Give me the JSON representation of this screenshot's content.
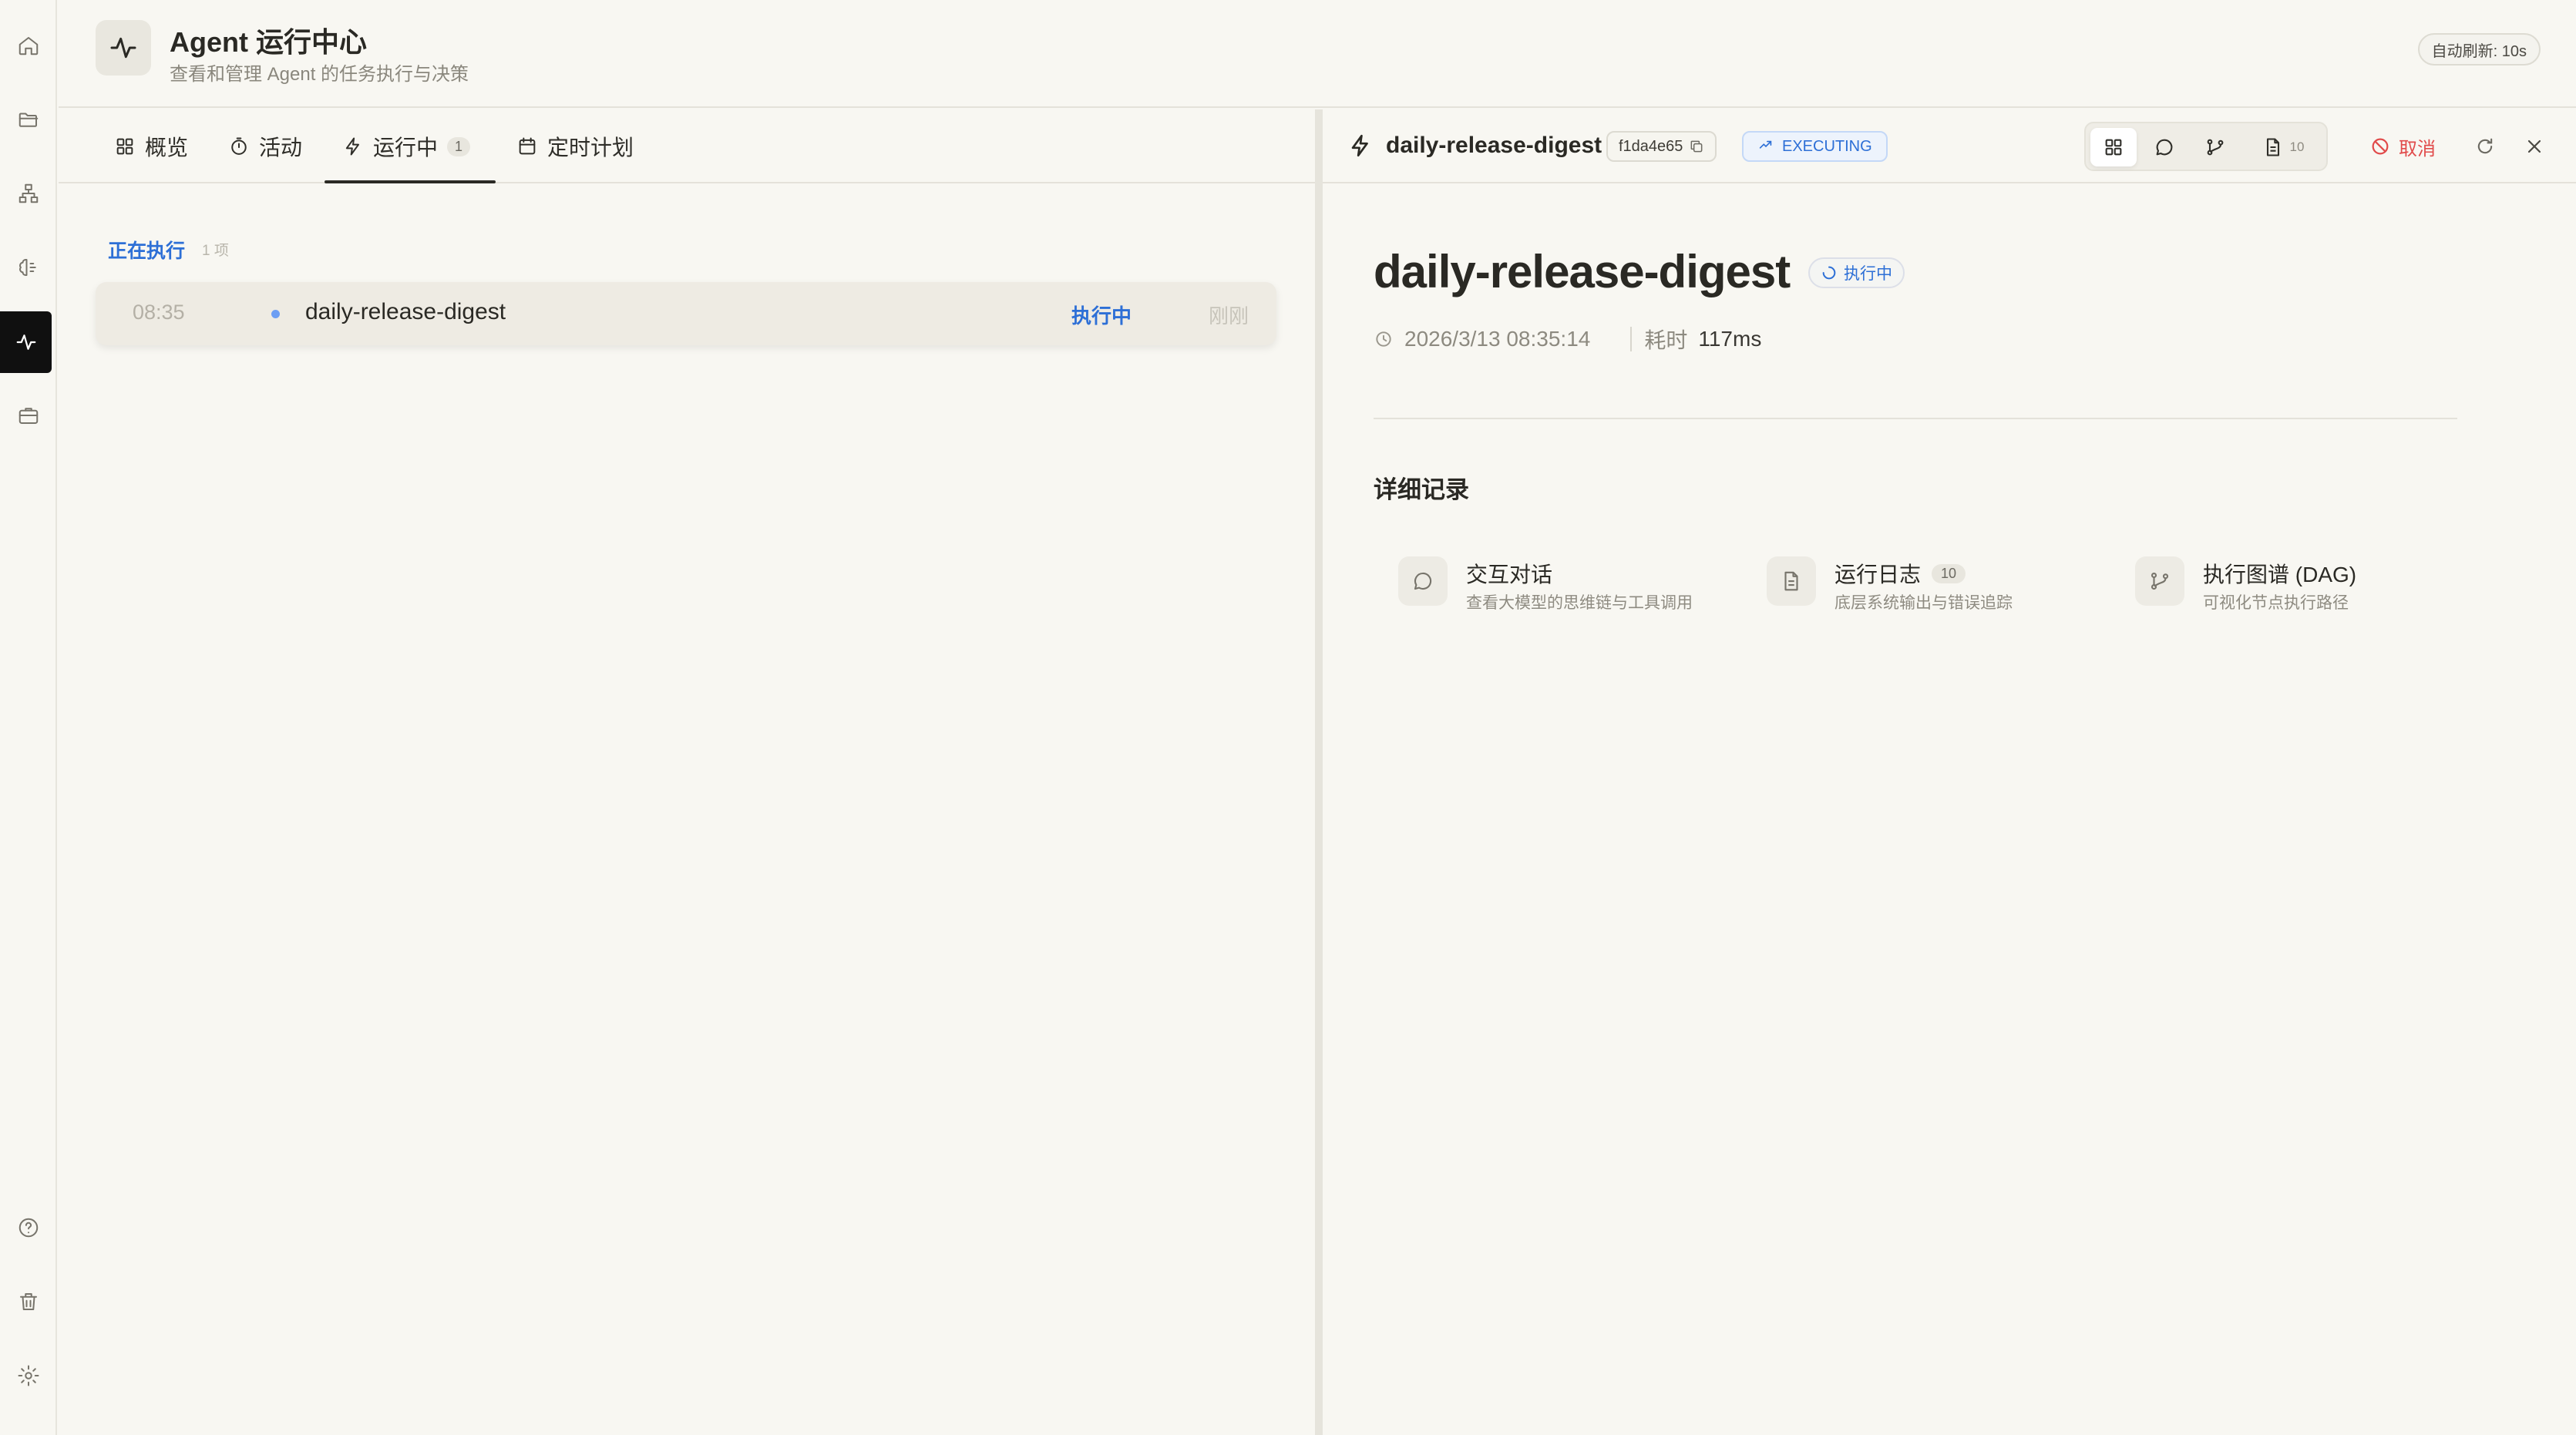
{
  "header": {
    "title": "Agent 运行中心",
    "subtitle": "查看和管理 Agent 的任务执行与决策",
    "auto_refresh": "自动刷新: 10s"
  },
  "sidebar": {
    "icons": [
      "home-icon",
      "folder-icon",
      "org-chart-icon",
      "brain-icon",
      "activity-icon",
      "briefcase-icon",
      "help-icon",
      "trash-icon",
      "settings-icon"
    ],
    "active": "activity-icon"
  },
  "tabs": [
    {
      "label": "概览",
      "icon": "grid-icon"
    },
    {
      "label": "活动",
      "icon": "timer-icon"
    },
    {
      "label": "运行中",
      "icon": "bolt-icon",
      "count": "1"
    },
    {
      "label": "定时计划",
      "icon": "calendar-icon"
    }
  ],
  "running": {
    "section_label": "正在执行",
    "section_count": "1 项",
    "rows": [
      {
        "time": "08:35",
        "name": "daily-release-digest",
        "status": "执行中",
        "ago": "刚刚"
      }
    ]
  },
  "detail": {
    "job_name": "daily-release-digest",
    "run_id": "f1da4e65",
    "state": "EXECUTING",
    "view_buttons": [
      {
        "icon": "grid-icon"
      },
      {
        "icon": "chat-icon"
      },
      {
        "icon": "branch-icon"
      },
      {
        "icon": "document-icon",
        "count": "10"
      }
    ],
    "cancel_label": "取消",
    "title": "daily-release-digest",
    "title_status": "执行中",
    "timestamp": "2026/3/13 08:35:14",
    "duration_label": "耗时",
    "duration_value": "117ms",
    "records_title": "详细记录",
    "records": [
      {
        "title": "交互对话",
        "desc": "查看大模型的思维链与工具调用",
        "icon": "chat-icon"
      },
      {
        "title": "运行日志",
        "badge": "10",
        "desc": "底层系统输出与错误追踪",
        "icon": "document-icon"
      },
      {
        "title": "执行图谱 (DAG)",
        "desc": "可视化节点执行路径",
        "icon": "branch-icon"
      }
    ]
  },
  "colors": {
    "accent_blue": "#2d6fd6",
    "danger_red": "#e14b4b",
    "background": "#f8f7f2",
    "active_rail": "#101010"
  }
}
